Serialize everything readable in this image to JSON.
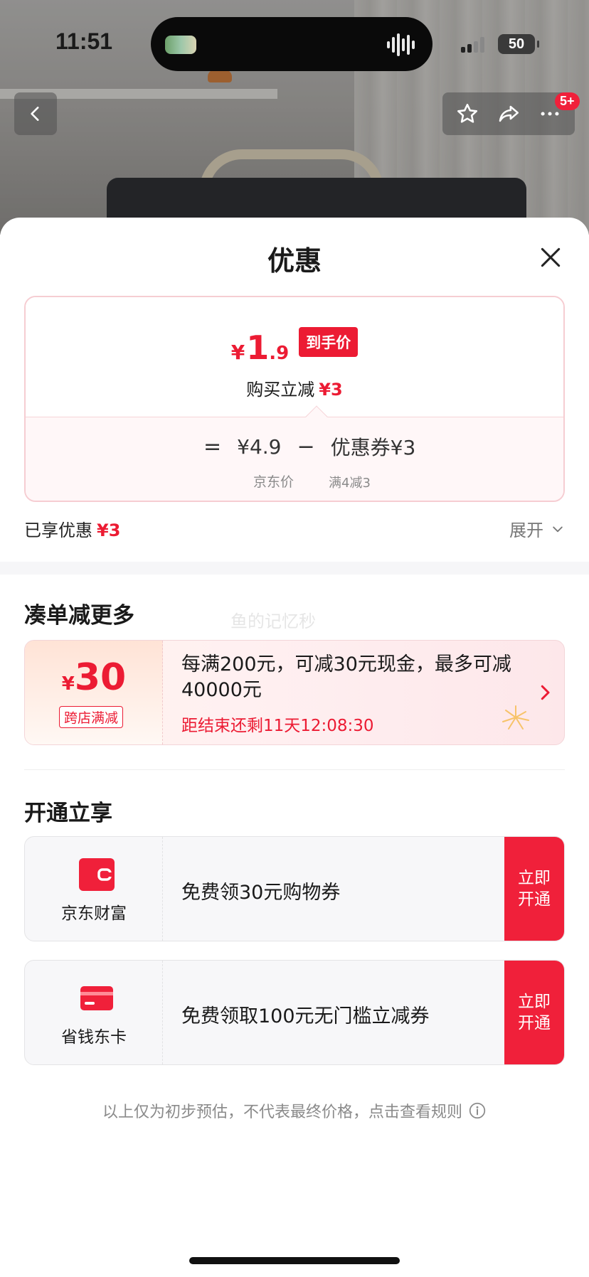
{
  "status_bar": {
    "time": "11:51",
    "battery": "50"
  },
  "top_nav": {
    "badge": "5+"
  },
  "sheet": {
    "title": "优惠",
    "price_card": {
      "price_yen": "¥",
      "price_int": "1",
      "price_dec": ".9",
      "price_tag": "到手价",
      "instant_label": "购买立减",
      "instant_value": "¥3",
      "formula": {
        "equals": "=",
        "jd_price": "¥4.9",
        "minus": "−",
        "coupon": "优惠券¥3"
      },
      "jd_price_label": "京东价",
      "coupon_rule": "满4减3"
    },
    "enjoyed": {
      "label": "已享优惠",
      "value": "¥3"
    },
    "expand_label": "展开",
    "more_section": {
      "title": "凑单减更多",
      "watermark": "鱼的记忆秒",
      "promo": {
        "yen": "¥",
        "amount": "30",
        "type": "跨店满减",
        "text": "每满200元，可减30元现金，最多可减40000元",
        "countdown": "距结束还剩11天12:08:30"
      }
    },
    "open_section": {
      "title": "开通立享",
      "items": [
        {
          "name": "京东财富",
          "desc": "免费领30元购物券",
          "cta": "立即开通"
        },
        {
          "name": "省钱东卡",
          "desc": "免费领取100元无门槛立减券",
          "cta": "立即开通"
        }
      ]
    },
    "footnote": "以上仅为初步预估，不代表最终价格，点击查看规则"
  },
  "colors": {
    "accent_red": "#ec1b33",
    "cta_red": "#f0203a"
  }
}
